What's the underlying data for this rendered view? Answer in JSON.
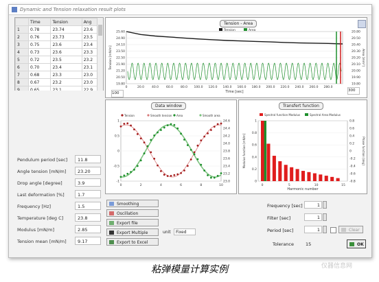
{
  "window": {
    "title": "Dynamic and Tension relaxation result plots"
  },
  "grid": {
    "headers": [
      "",
      "Time",
      "Tension",
      "Ang"
    ],
    "rows": [
      [
        "1",
        "0.78",
        "23.74",
        "23.6"
      ],
      [
        "2",
        "0.76",
        "23.73",
        "23.5"
      ],
      [
        "3",
        "0.75",
        "23.6",
        "23.4"
      ],
      [
        "4",
        "0.73",
        "23.6",
        "23.3"
      ],
      [
        "5",
        "0.72",
        "23.5",
        "23.2"
      ],
      [
        "6",
        "0.70",
        "23.4",
        "23.1"
      ],
      [
        "7",
        "0.68",
        "23.3",
        "23.0"
      ],
      [
        "8",
        "0.67",
        "23.2",
        "23.0"
      ],
      [
        "9",
        "0.65",
        "23.1",
        "22.9"
      ]
    ]
  },
  "params": [
    {
      "label": "Pendulum period [sec]",
      "value": "11.8"
    },
    {
      "label": "Angle tension [mN/m]",
      "value": "23.20"
    },
    {
      "label": "Drop angle [degree]",
      "value": "3.9"
    },
    {
      "label": "Last deformation [%]",
      "value": "1.7"
    },
    {
      "label": "Frequency [Hz]",
      "value": "1.5"
    },
    {
      "label": "Temperature [deg C]",
      "value": "23.8"
    },
    {
      "label": "Modulus [mN/m]",
      "value": "2.85"
    },
    {
      "label": "Tension mean [mN/m]",
      "value": "9.17"
    }
  ],
  "buttons": {
    "smoothing": "Smoothing",
    "oscillation": "Oscillation",
    "export": "Export file",
    "exp_fit": "Export Multiple",
    "export_plot": "Export to Excel",
    "unit_label": "unit",
    "unit_value": "Fixed"
  },
  "right_fields": [
    {
      "label": "Frequency [sec]",
      "value": "1"
    },
    {
      "label": "Filter [sec]",
      "value": "1"
    },
    {
      "label": "Period [sec]",
      "value": "1"
    },
    {
      "label": "Tolerance",
      "value": "15"
    }
  ],
  "footer": {
    "clear_label": "Clear",
    "ok_label": "OK"
  },
  "top_range": {
    "left": "100",
    "right": "300"
  },
  "caption": "粘弹模量计算实例",
  "watermark": "仪器信息网",
  "chart_data": [
    {
      "type": "line",
      "title": "Tension - Area",
      "xlabel": "Time [sec]",
      "ylabel": "Tension [mN/m]",
      "y2label": "Area [mm²]",
      "series": [
        {
          "name": "Tension",
          "color": "#1a1a1a",
          "x": [
            0,
            20,
            40,
            60,
            80,
            100,
            120,
            140,
            160,
            180,
            200,
            220,
            240,
            260,
            280,
            300
          ],
          "values": [
            25.6,
            25.0,
            24.7,
            24.5,
            24.3,
            24.1,
            23.95,
            23.8,
            23.7,
            23.6,
            23.5,
            23.4,
            23.3,
            23.25,
            23.2,
            23.1
          ]
        },
        {
          "name": "Area",
          "color": "#1e8f2c",
          "oscillating": true,
          "cycles": 36
        }
      ],
      "xticks": [
        "0",
        "20.0",
        "40.0",
        "60.0",
        "80.0",
        "100.0",
        "120.0",
        "140.0",
        "160.0",
        "180.0",
        "200.0",
        "220.0",
        "240.0",
        "260.0",
        "280.0"
      ],
      "yticks": [
        "25.60",
        "24.90",
        "24.10",
        "23.50",
        "22.50",
        "21.90",
        "21.20",
        "20.50",
        "19.80"
      ],
      "y2ticks": [
        "20.80",
        "20.50",
        "20.40",
        "20.30",
        "20.20",
        "20.10",
        "20.00",
        "19.90",
        "19.80"
      ]
    },
    {
      "type": "line",
      "title": "Data window",
      "series": [
        {
          "name": "Tension",
          "color": "#a51f1f"
        },
        {
          "name": "Smooth tension",
          "color": "#d77b7b"
        },
        {
          "name": "Area",
          "color": "#1e8f2c"
        },
        {
          "name": "Smooth area",
          "color": "#7cc27e"
        }
      ],
      "x": [
        0,
        1,
        2,
        3,
        4,
        5,
        6,
        7,
        8,
        9,
        10
      ],
      "xticks": [
        "0",
        "2",
        "4",
        "6",
        "8",
        "10"
      ],
      "yticks": [
        "1",
        "0.5",
        "0",
        "-0.5",
        "-1"
      ],
      "y2ticks": [
        "24.6",
        "24.4",
        "24.2",
        "24.0",
        "23.8",
        "23.6",
        "23.4",
        "23.2",
        "23.0"
      ]
    },
    {
      "type": "bar",
      "title": "Transfert function",
      "xlabel": "Harmonic number",
      "ylabel": "Modulus function [mN/m]",
      "y2label": "Phase function [deg]",
      "series": [
        {
          "name": "Spectral function Modulus",
          "color": "#e01d1d",
          "values": [
            1.0,
            0.62,
            0.42,
            0.33,
            0.27,
            0.23,
            0.2,
            0.17,
            0.15,
            0.13,
            0.11,
            0.09,
            0.07,
            0.05
          ]
        },
        {
          "name": "Spectral Area Modulus",
          "color": "#1e8f2c",
          "values": [
            1.0,
            0,
            0,
            0,
            0,
            0,
            0,
            0,
            0,
            0,
            0,
            0,
            0,
            0
          ]
        }
      ],
      "xticks": [
        "0",
        "5",
        "10",
        "15"
      ],
      "yticks": [
        "1",
        "0.8",
        "0.6",
        "0.4",
        "0.2",
        "0"
      ],
      "y2ticks": [
        "0.8",
        "0.6",
        "0.4",
        "0.2",
        "0",
        "-0.2",
        "-0.4",
        "-0.6",
        "-0.8"
      ]
    }
  ]
}
